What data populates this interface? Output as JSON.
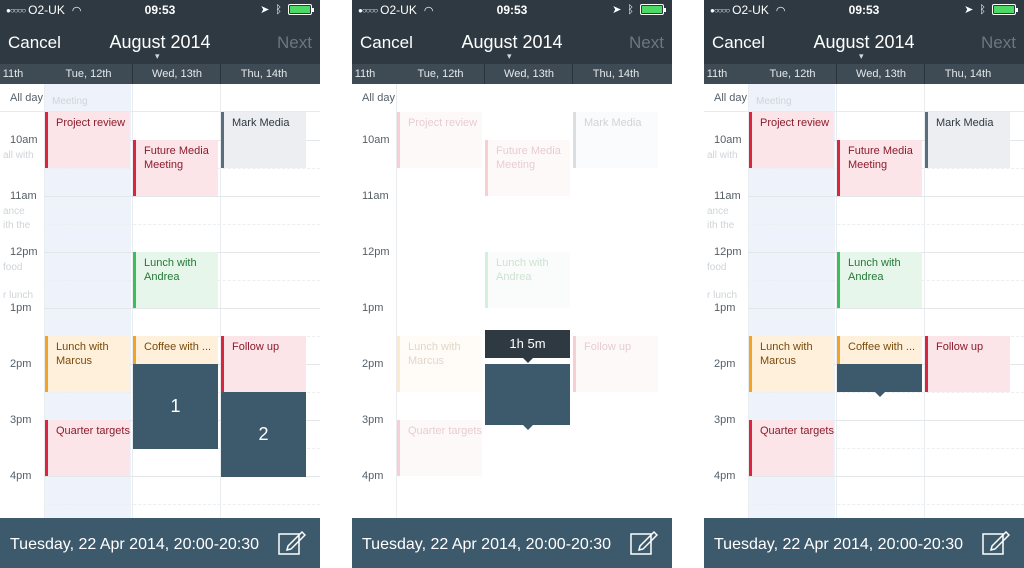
{
  "status": {
    "carrier": "O2-UK",
    "time": "09:53"
  },
  "nav": {
    "cancel": "Cancel",
    "title": "August 2014",
    "next": "Next"
  },
  "days": [
    "11th",
    "Tue, 12th",
    "Wed, 13th",
    "Thu, 14th"
  ],
  "all_day": "All day",
  "time_labels": [
    "10am",
    "11am",
    "12pm",
    "1pm",
    "2pm",
    "3pm",
    "4pm"
  ],
  "ghost_text": [
    "Meeting",
    "all with",
    "ance",
    "ith the",
    "food",
    "r lunch"
  ],
  "events": {
    "project_review": "Project review",
    "future_media": "Future Media Meeting",
    "mark_media": "Mark Media",
    "lunch_andrea": "Lunch with Andrea",
    "lunch_marcus": "Lunch with Marcus",
    "coffee": "Coffee with ...",
    "follow_up": "Follow up",
    "quarter_targets": "Quarter targets"
  },
  "selections": {
    "first": "1",
    "second": "2",
    "duration": "1h 5m"
  },
  "footer": {
    "text": "Tuesday, 22 Apr 2014, 20:00-20:30"
  },
  "icons": [
    "location-arrow-icon",
    "bluetooth-icon",
    "battery-icon",
    "wifi-icon",
    "compose-icon",
    "chevron-down-icon"
  ],
  "colors": {
    "header": "#2e3941",
    "day_bar": "#3e4b54",
    "footer": "#3d5a6c",
    "selection": "#3d5a6c",
    "red": "#d7263d",
    "green": "#3cbf5a",
    "orange": "#f2a226"
  }
}
